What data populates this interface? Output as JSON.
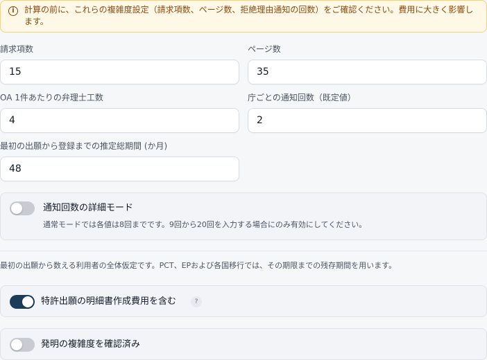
{
  "alert": {
    "icon": "info-circle-icon",
    "text": "計算の前に、これらの複雑度設定（請求項数、ページ数、拒絶理由通知の回数）をご確認ください。費用に大きく影響します。"
  },
  "fields": {
    "claims": {
      "label": "請求項数",
      "value": "15"
    },
    "pages": {
      "label": "ページ数",
      "value": "35"
    },
    "hours_per_oa": {
      "label": "OA 1件あたりの弁理士工数",
      "value": "4"
    },
    "notices_per_office": {
      "label": "庁ごとの通知回数（既定値）",
      "value": "2"
    },
    "total_period": {
      "label": "最初の出願から登録までの推定総期間 (か月)",
      "value": "48"
    }
  },
  "advanced_mode": {
    "title": "通知回数の詳細モード",
    "description": "通常モードでは各値は8回までです。9回から20回を入力する場合にのみ有効にしてください。",
    "enabled": false
  },
  "note": "最初の出願から数える利用者の全体仮定です。PCT、EPおよび各国移行では、その期限までの残存期間を用います。",
  "include_drafting": {
    "title": "特許出願の明細書作成費用を含む",
    "help": "?",
    "enabled": true
  },
  "complexity_confirmed": {
    "title": "発明の複雑度を確認済み",
    "enabled": false
  },
  "colors": {
    "toggle_on": "#1c3d5a",
    "toggle_off": "#c8ccd2",
    "alert_bg": "#fff8e6",
    "alert_border": "#f5d27a"
  }
}
